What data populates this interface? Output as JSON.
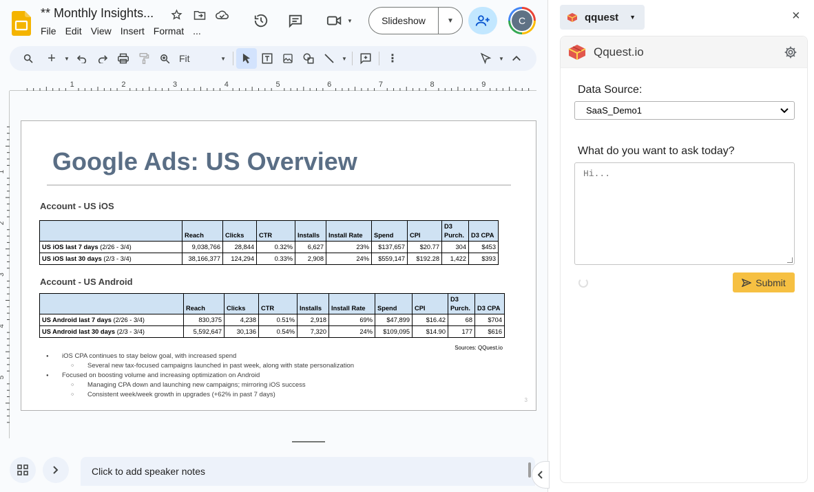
{
  "doc": {
    "title": "** Monthly Insights...",
    "menu": [
      "File",
      "Edit",
      "View",
      "Insert",
      "Format",
      "..."
    ]
  },
  "header": {
    "slideshow_label": "Slideshow",
    "avatar_letter": "C"
  },
  "toolbar": {
    "zoom": "Fit"
  },
  "ruler": {
    "h_marks": [
      "1",
      "2",
      "3",
      "4",
      "5",
      "6",
      "7",
      "8",
      "9"
    ],
    "v_marks": [
      "1",
      "2",
      "3",
      "4",
      "5"
    ]
  },
  "slide": {
    "title": "Google Ads: US Overview",
    "ios_heading": "Account - US iOS",
    "android_heading": "Account - US Android",
    "columns": [
      "Reach",
      "Clicks",
      "CTR",
      "Installs",
      "Install Rate",
      "Spend",
      "CPI",
      "D3 Purch.",
      "D3 CPA"
    ],
    "ios_rows": [
      {
        "label": "US iOS last 7 days",
        "range": "(2/26 - 3/4)",
        "values": [
          "9,038,766",
          "28,844",
          "0.32%",
          "6,627",
          "23%",
          "$137,657",
          "$20.77",
          "304",
          "$453"
        ]
      },
      {
        "label": "US iOS last 30 days",
        "range": "(2/3 - 3/4)",
        "values": [
          "38,166,377",
          "124,294",
          "0.33%",
          "2,908",
          "24%",
          "$559,147",
          "$192.28",
          "1,422",
          "$393"
        ]
      }
    ],
    "android_rows": [
      {
        "label": "US Android last 7 days",
        "range": "(2/26 - 3/4)",
        "values": [
          "830,375",
          "4,238",
          "0.51%",
          "2,918",
          "69%",
          "$47,899",
          "$16.42",
          "68",
          "$704"
        ]
      },
      {
        "label": "US Android last 30 days",
        "range": "(2/3 - 3/4)",
        "values": [
          "5,592,647",
          "30,136",
          "0.54%",
          "7,320",
          "24%",
          "$109,095",
          "$14.90",
          "177",
          "$616"
        ]
      }
    ],
    "sources": "Sources: QQuest.io",
    "bullets": [
      {
        "level": 1,
        "text": "iOS CPA continues to stay below goal, with increased spend"
      },
      {
        "level": 2,
        "text": "Several new tax-focused campaigns launched in past week, along with state personalization"
      },
      {
        "level": 1,
        "text": "Focused on boosting volume and increasing optimization on Android"
      },
      {
        "level": 2,
        "text": "Managing CPA down and launching new campaigns; mirroring iOS success"
      },
      {
        "level": 2,
        "text": "Consistent week/week growth in upgrades (+62% in past 7 days)"
      }
    ],
    "page_number": "3"
  },
  "notes": {
    "placeholder": "Click to add speaker notes"
  },
  "side_panel": {
    "addon_name": "qquest",
    "brand": "Qquest.io",
    "data_source_label": "Data Source:",
    "data_source_value": "SaaS_Demo1",
    "question_label": "What do you want to ask today?",
    "question_placeholder": "Hi...",
    "submit_label": "Submit",
    "accent": "#f6c042"
  }
}
